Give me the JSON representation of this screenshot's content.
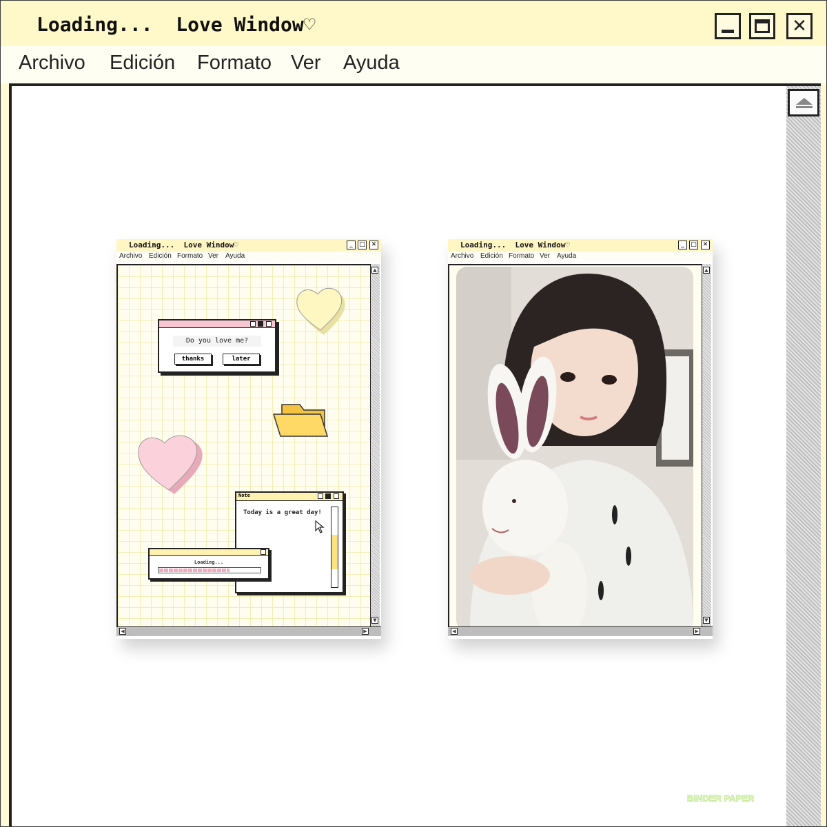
{
  "window": {
    "title": "Loading...  Love Window♡",
    "minimize_glyph": "_",
    "close_glyph": "✕"
  },
  "menu": {
    "items": [
      "Archivo",
      "Edición",
      "Formato",
      "Ver",
      "Ayuda"
    ]
  },
  "mini_left": {
    "title": "Loading...  Love Window♡",
    "menu": [
      "Archivo",
      "Edición",
      "Formato",
      "Ver",
      "Ayuda"
    ],
    "dialog_question": "Do you love me?",
    "btn_thanks": "thanks",
    "btn_later": "later",
    "note_title": "Note",
    "note_text": "Today is a great day!",
    "loading_text": "Loading...",
    "loading_progress": 0.7
  },
  "mini_right": {
    "title": "Loading...  Love Window♡",
    "menu": [
      "Archivo",
      "Edición",
      "Formato",
      "Ver",
      "Ayuda"
    ]
  },
  "watermark": "BINDER PAPER",
  "colors": {
    "titlebar": "#fff8c8",
    "accent_pink": "#f7c6d2",
    "heart_yellow": "#fff6b8",
    "folder_yellow": "#ffd65c",
    "progress_pink": "#f4a9bf"
  },
  "icons": [
    "minimize-icon",
    "maximize-icon",
    "close-icon",
    "scroll-up-icon",
    "heart-icon",
    "folder-icon",
    "cursor-icon"
  ]
}
